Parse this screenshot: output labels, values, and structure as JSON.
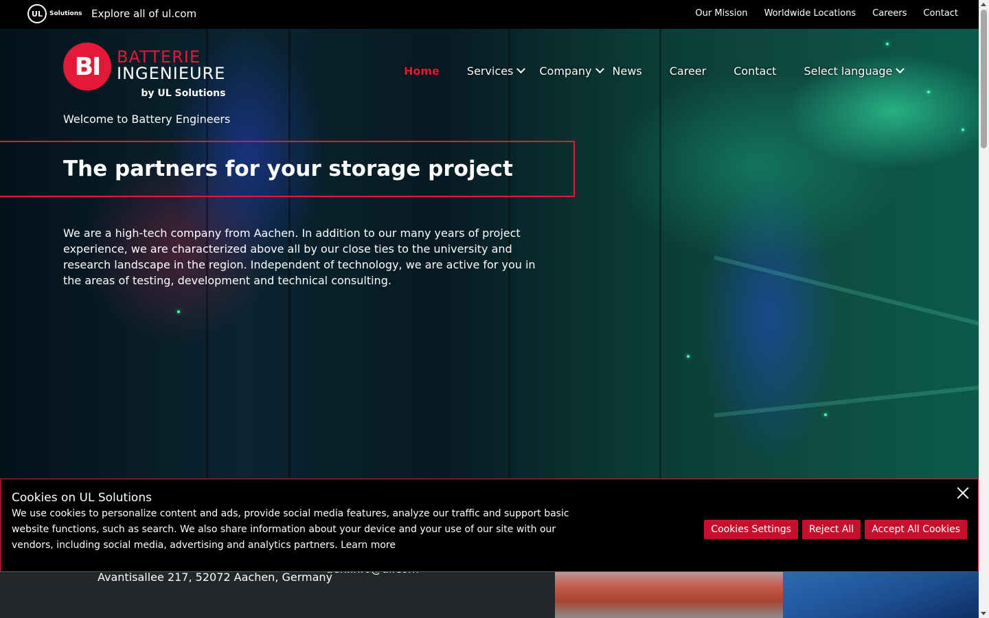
{
  "topbar": {
    "ul_logo_text": "UL",
    "ul_logo_sub": "Solutions",
    "explore_label": "Explore all of ul.com",
    "links": [
      "Our Mission",
      "Worldwide Locations",
      "Careers",
      "Contact"
    ]
  },
  "brand": {
    "mark": "BI",
    "line1": "BATTERIE",
    "line2": "INGENIEURE",
    "line3": "by UL Solutions"
  },
  "main_nav": {
    "home": "Home",
    "services": "Services",
    "company": "Company",
    "news": "News",
    "career": "Career",
    "contact": "Contact",
    "language": "Select language"
  },
  "hero": {
    "welcome": "Welcome to Battery Engineers",
    "headline": "The partners for your storage project",
    "intro": "We are a high-tech company from Aachen. In addition to our many years of project experience, we are characterized above all by our close ties to the university and research landscape in the region. Independent of technology, we are active for you in the areas of testing, development and technical consulting."
  },
  "footer": {
    "address": "Avantisallee 217, 52072 Aachen, Germany",
    "email": "aeh.info@ul.com"
  },
  "cookie_banner": {
    "title": "Cookies on UL Solutions",
    "text": "We use cookies to personalize content and ads, provide social media features, analyze our traffic and support basic website functions, such as search. We also share information about your device and your use of our site with our vendors, including social media, advertising and analytics partners.",
    "learn_more": "Learn more",
    "settings_label": "Cookies Settings",
    "reject_label": "Reject All",
    "accept_label": "Accept All Cookies"
  },
  "colors": {
    "accent": "#e31937",
    "button": "#c8102e",
    "topbar": "#000000",
    "footer": "#23272c"
  }
}
